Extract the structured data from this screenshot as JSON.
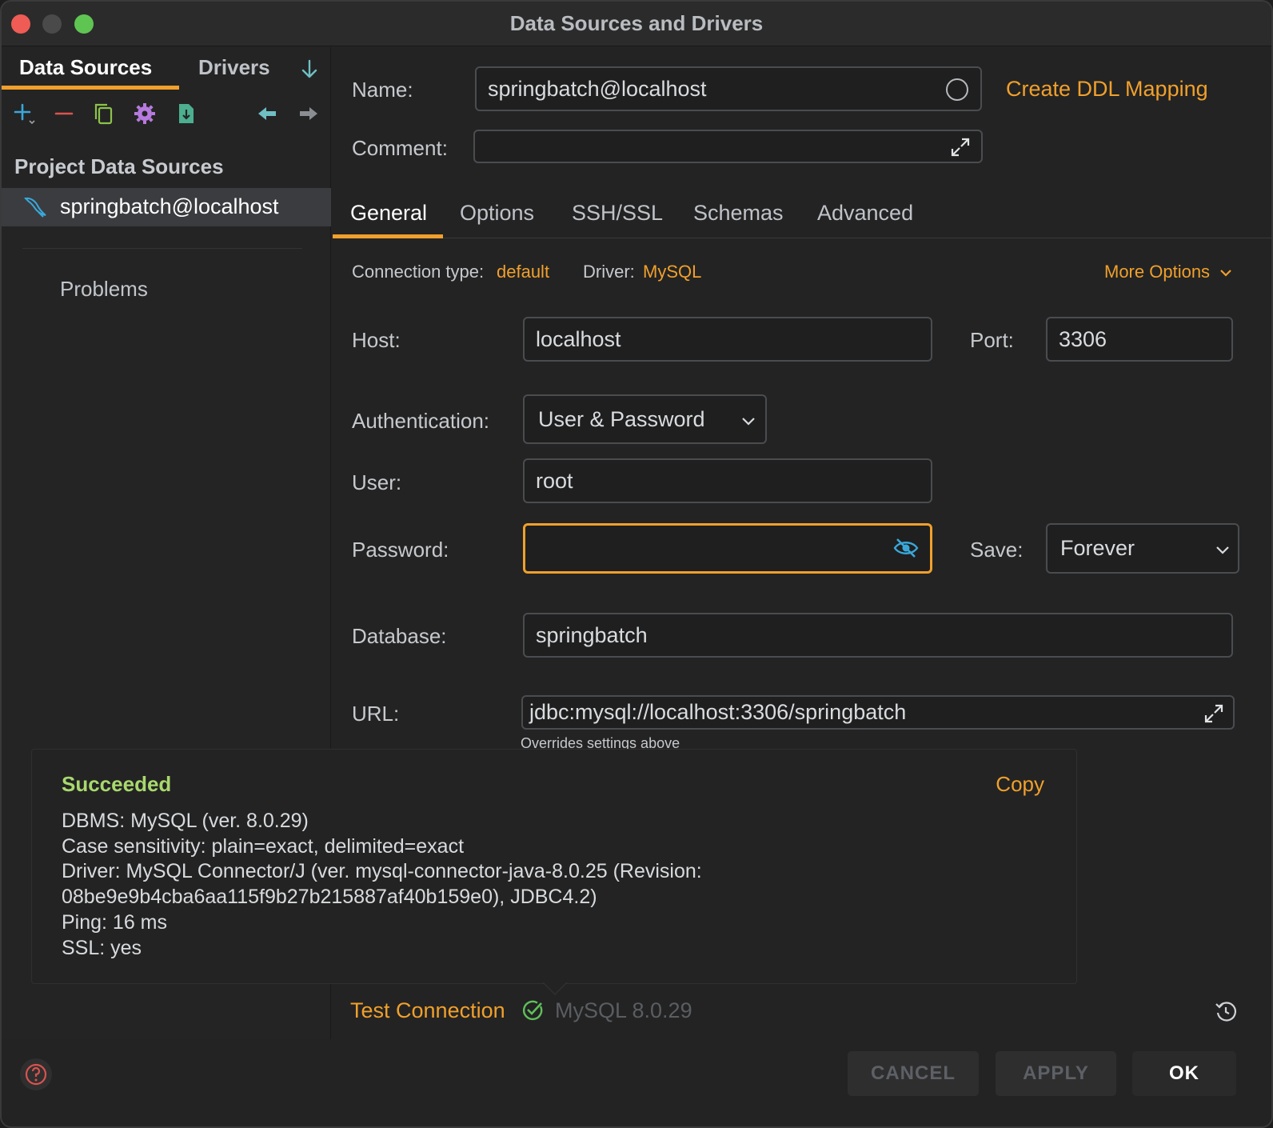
{
  "window": {
    "title": "Data Sources and Drivers"
  },
  "sidebar": {
    "tabs": [
      "Data Sources",
      "Drivers"
    ],
    "section_title": "Project Data Sources",
    "items": [
      {
        "label": "springbatch@localhost",
        "icon": "mysql-dolphin-icon"
      }
    ],
    "problems_label": "Problems",
    "toolbar_icons": [
      "add-icon",
      "remove-icon",
      "duplicate-icon",
      "settings-icon",
      "import-icon",
      "back-icon",
      "forward-icon"
    ]
  },
  "form": {
    "name_label": "Name:",
    "name_value": "springbatch@localhost",
    "create_ddl_label": "Create DDL Mapping",
    "comment_label": "Comment:",
    "comment_value": ""
  },
  "tabs": [
    "General",
    "Options",
    "SSH/SSL",
    "Schemas",
    "Advanced"
  ],
  "general": {
    "connection_type_label": "Connection type:",
    "connection_type_value": "default",
    "driver_label": "Driver:",
    "driver_value": "MySQL",
    "more_options_label": "More Options",
    "host_label": "Host:",
    "host_value": "localhost",
    "port_label": "Port:",
    "port_value": "3306",
    "auth_label": "Authentication:",
    "auth_value": "User & Password",
    "user_label": "User:",
    "user_value": "root",
    "password_label": "Password:",
    "password_value": "",
    "save_label": "Save:",
    "save_value": "Forever",
    "database_label": "Database:",
    "database_value": "springbatch",
    "url_label": "URL:",
    "url_value": "jdbc:mysql://localhost:3306/springbatch",
    "url_hint": "Overrides settings above"
  },
  "result": {
    "status": "Succeeded",
    "copy_label": "Copy",
    "lines": [
      "DBMS: MySQL (ver. 8.0.29)",
      "Case sensitivity: plain=exact, delimited=exact",
      "Driver: MySQL Connector/J (ver. mysql-connector-java-8.0.25 (Revision:",
      "08be9e9b4cba6aa115f9b27b215887af40b159e0), JDBC4.2)",
      "Ping: 16 ms",
      "SSL: yes"
    ]
  },
  "footer": {
    "test_connection_label": "Test Connection",
    "test_result": "MySQL 8.0.29",
    "buttons": {
      "cancel": "CANCEL",
      "apply": "APPLY",
      "ok": "OK"
    }
  },
  "colors": {
    "accent": "#f0a02c",
    "success": "#a9d86e",
    "background": "#232323"
  }
}
